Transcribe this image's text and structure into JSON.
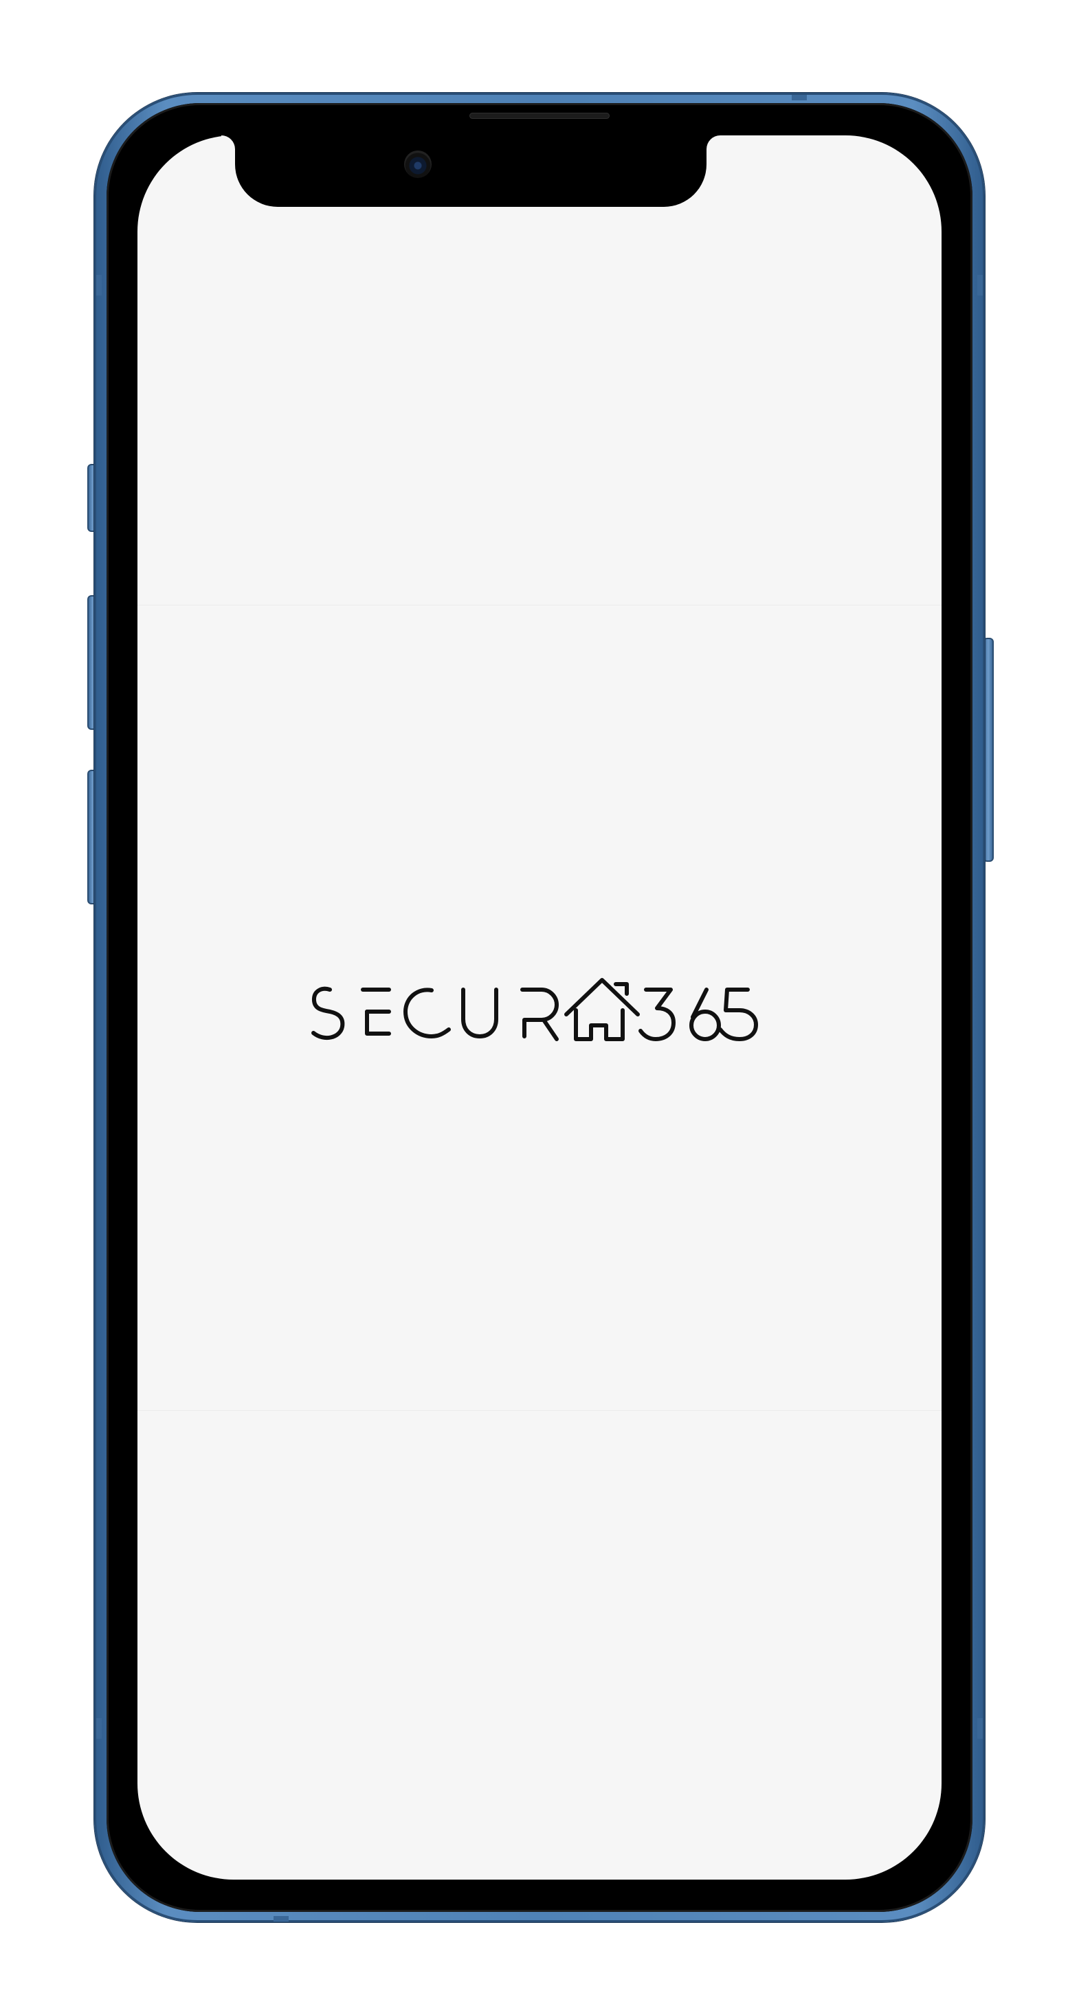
{
  "device": {
    "frame_color": "#4f82b6",
    "screen_color": "#f6f6f6"
  },
  "splash": {
    "logo_text": "SECUR365",
    "logo_color": "#111111"
  }
}
